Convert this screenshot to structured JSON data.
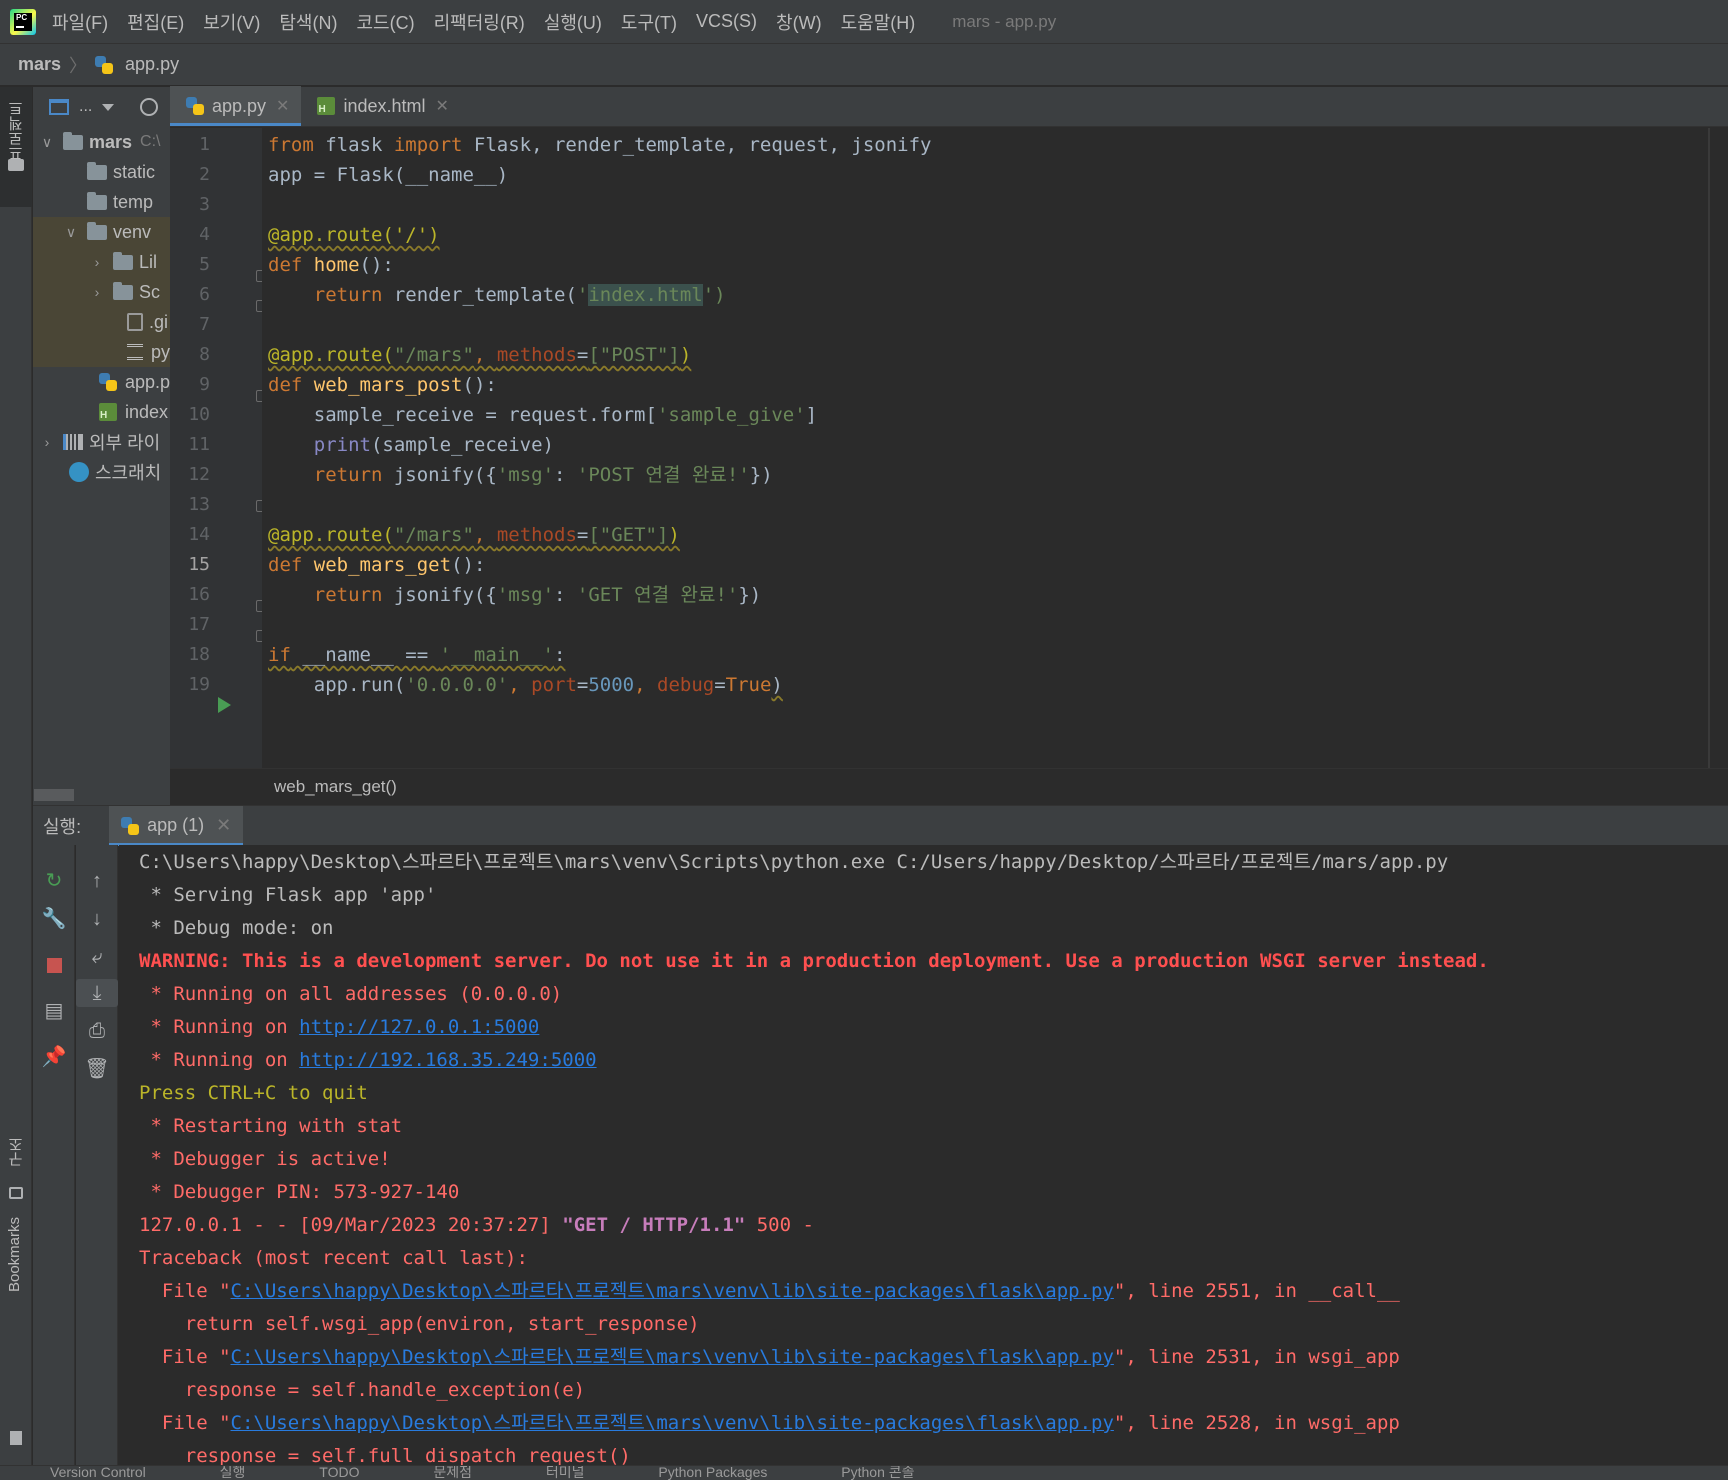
{
  "menu": {
    "items": [
      "파일(F)",
      "편집(E)",
      "보기(V)",
      "탐색(N)",
      "코드(C)",
      "리팩터링(R)",
      "실행(U)",
      "도구(T)",
      "VCS(S)",
      "창(W)",
      "도움말(H)"
    ],
    "window_title": "mars - app.py",
    "logo_text": "PC"
  },
  "breadcrumb": {
    "project": "mars",
    "file": "app.py"
  },
  "left_strip": {
    "project_label": "프로젝트",
    "structure_label": "구조",
    "bookmarks_label": "Bookmarks"
  },
  "project_panel": {
    "toolbar_label": "...",
    "tree": [
      {
        "label": "mars",
        "path": "C:\\"
      },
      {
        "label": "static"
      },
      {
        "label": "temp"
      },
      {
        "label": "venv"
      },
      {
        "label": "Lil"
      },
      {
        "label": "Sc"
      },
      {
        "label": ".gi"
      },
      {
        "label": "py"
      },
      {
        "label": "app.p"
      },
      {
        "label": "index"
      },
      {
        "label": "외부 라이"
      },
      {
        "label": "스크래치"
      }
    ]
  },
  "tabs": [
    {
      "label": "app.py",
      "active": true
    },
    {
      "label": "index.html",
      "active": false
    }
  ],
  "editor": {
    "line_numbers": [
      "1",
      "2",
      "3",
      "4",
      "5",
      "6",
      "7",
      "8",
      "9",
      "10",
      "11",
      "12",
      "13",
      "14",
      "15",
      "16",
      "17",
      "18",
      "19"
    ],
    "current_line": "15",
    "tokens": {
      "from": "from",
      "import": "import",
      "l1_rest": " flask ",
      "l1_names": " Flask, render_template, request, jsonify",
      "l2": "app = Flask(__name__)",
      "route_root": "@app.route('/')",
      "def": "def",
      "home": "home",
      "paren": "():",
      "return": "return",
      "rt_call": "render_template(",
      "q": "'",
      "index_html": "index.html",
      "close_paren": "')",
      "route_post_a": "@app.route(",
      "route_post_s": "\"/mars\"",
      "comma": ", ",
      "methods": "methods",
      "eq": "=",
      "post_list": "[\"POST\"]",
      "rparen": ")",
      "web_mars_post": "web_mars_post",
      "sample_lhs": "sample_receive = request.form[",
      "sample_give": "'sample_give'",
      "rbracket": "]",
      "print": "print",
      "print_arg": "(sample_receive)",
      "jsonify_open": "jsonify({",
      "msg_key": "'msg'",
      "colon": ": ",
      "post_msg": "'POST 연결 완료!'",
      "jsonify_close": "})",
      "get_list": "[\"GET\"]",
      "web_mars_get": "web_mars_get",
      "get_msg": "'GET 연결 완료!'",
      "if": "if",
      "name_cmp": " __name__ == ",
      "main_str": "'__main__'",
      "colon_end": ":",
      "app_run": "app.run(",
      "host": "'0.0.0.0'",
      "port": "port",
      "port_val": "5000",
      "debug": "debug",
      "true": "True"
    },
    "crumb": "web_mars_get()"
  },
  "run_panel": {
    "title": "실행:",
    "tab_label": "app (1)",
    "console": {
      "l1": "C:\\Users\\happy\\Desktop\\스파르타\\프로젝트\\mars\\venv\\Scripts\\python.exe C:/Users/happy/Desktop/스파르타/프로젝트/mars/app.py",
      "l2": " * Serving Flask app 'app'",
      "l3": " * Debug mode: on",
      "l4": "WARNING: This is a development server. Do not use it in a production deployment. Use a production WSGI server instead.",
      "l5": " * Running on all addresses (0.0.0.0)",
      "l6_pre": " * Running on ",
      "l6_link": "http://127.0.0.1:5000",
      "l7_pre": " * Running on ",
      "l7_link": "http://192.168.35.249:5000",
      "l8": "Press CTRL+C to quit",
      "l9": " * Restarting with stat",
      "l10": " * Debugger is active!",
      "l11": " * Debugger PIN: 573-927-140",
      "l12_pre": "127.0.0.1 - - [09/Mar/2023 20:37:27] ",
      "l12_get": "\"GET / HTTP/1.1\"",
      "l12_post": " 500 -",
      "l13": "Traceback (most recent call last):",
      "file_pre": "  File \"",
      "file_link": "C:\\Users\\happy\\Desktop\\스파르타\\프로젝트\\mars\\venv\\lib\\site-packages\\flask\\app.py",
      "f1_post": "\", line 2551, in __call__",
      "f1_code": "    return self.wsgi_app(environ, start_response)",
      "f2_post": "\", line 2531, in wsgi_app",
      "f2_code": "    response = self.handle_exception(e)",
      "f3_post": "\", line 2528, in wsgi_app",
      "f3_code": "    response = self.full_dispatch_request()"
    }
  },
  "bottom_bar": [
    "Version Control",
    "실행",
    "TODO",
    "문제점",
    "터미널",
    "Python Packages",
    "Python 콘솔"
  ],
  "colors": {
    "accent": "#4a88c7",
    "run_green": "#499c54",
    "error": "#ff6b68",
    "link": "#287bde"
  }
}
